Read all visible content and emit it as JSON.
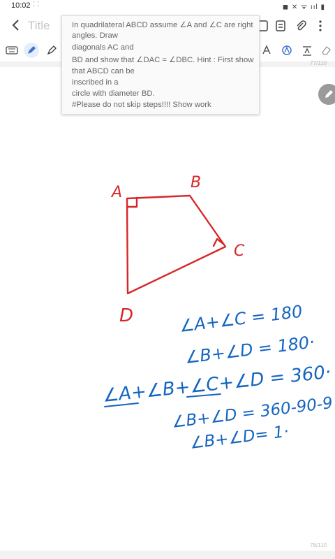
{
  "status": {
    "time": "10:02",
    "dots": "⁚ ⁚",
    "indicators": "◼ ✕ ᯤ ııl ▮"
  },
  "header": {
    "title": "Title"
  },
  "question": {
    "lines": [
      "In quadrilateral ABCD assume ∠A and ∠C are right",
      "angles. Draw",
      "diagonals AC and",
      "BD and show that ∠DAC = ∠DBC. Hint : First show",
      "that ABCD can be",
      "inscribed in a",
      "circle with diameter BD.",
      "#Please do not skip steps!!!! Show work"
    ]
  },
  "page": {
    "top_number": "77/110",
    "bottom_number": "78/110"
  },
  "drawing": {
    "labels": {
      "a": "A",
      "b": "B",
      "c": "C",
      "d": "D"
    },
    "equations": [
      "∠A+∠C = 180",
      "∠B+∠D = 180·",
      "∠A+∠B+∠C+∠D = 360·",
      "∠B+∠D = 360-90-9",
      "∠B+∠D= 1·"
    ]
  },
  "colors": {
    "red_ink": "#d62728",
    "blue_ink": "#1565c0",
    "accent": "#3b6fd6"
  }
}
